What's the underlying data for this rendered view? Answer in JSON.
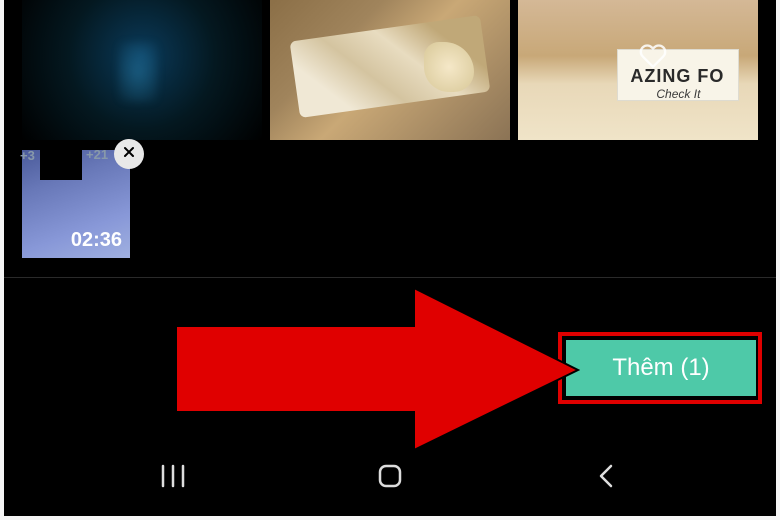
{
  "gallery": {
    "items": [
      {
        "caption_partial": "AZING FO",
        "caption_sub": "Check It"
      }
    ]
  },
  "selected": {
    "badge_left": "+3",
    "badge_right": "+21",
    "duration": "02:36"
  },
  "toolbar": {
    "add_label": "Thêm (1)"
  },
  "colors": {
    "accent": "#4ec9a8",
    "highlight": "#e00000"
  }
}
